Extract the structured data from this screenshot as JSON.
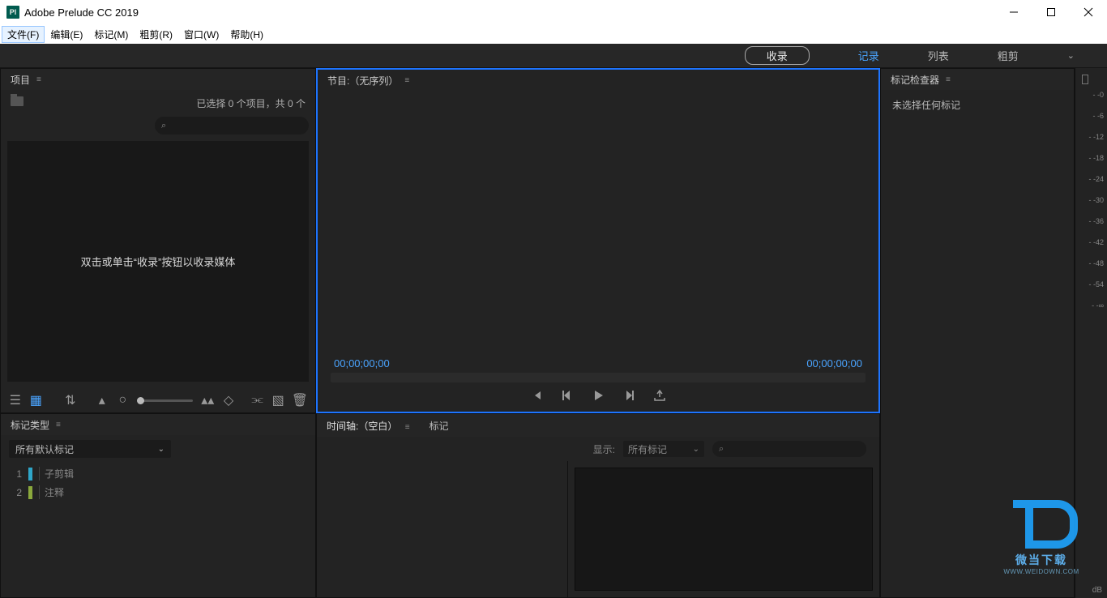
{
  "app": {
    "title": "Adobe Prelude CC 2019",
    "logo": "Pl"
  },
  "menu": {
    "file": "文件(F)",
    "edit": "编辑(E)",
    "marker": "标记(M)",
    "rough": "粗剪(R)",
    "window": "窗口(W)",
    "help": "帮助(H)"
  },
  "workspaces": {
    "ingest": "收录",
    "log": "记录",
    "list": "列表",
    "rough": "粗剪"
  },
  "project": {
    "panel_title": "项目",
    "status": "已选择 0 个项目，共 0 个",
    "placeholder": "双击或单击“收录”按钮以收录媒体"
  },
  "monitor": {
    "title": "节目:（无序列）",
    "tc_left": "00;00;00;00",
    "tc_right": "00;00;00;00"
  },
  "inspector": {
    "title": "标记检查器",
    "empty": "未选择任何标记"
  },
  "markertype": {
    "title": "标记类型",
    "select": "所有默认标记",
    "rows": [
      {
        "n": "1",
        "label": "子剪辑",
        "color": "#2fa6c9"
      },
      {
        "n": "2",
        "label": "注释",
        "color": "#8aa83c"
      }
    ]
  },
  "timeline": {
    "tab_timeline": "时间轴:（空白）",
    "tab_marker": "标记",
    "show_caption": "显示:",
    "show_select": "所有标记"
  },
  "meter": {
    "ticks": [
      "- -0",
      "- -6",
      "- -12",
      "- -18",
      "- -24",
      "- -30",
      "- -36",
      "- -42",
      "- -48",
      "- -54",
      "- -∞"
    ],
    "unit": "dB"
  },
  "watermark": {
    "line1": "微当下载",
    "line2": "WWW.WEIDOWN.COM"
  }
}
